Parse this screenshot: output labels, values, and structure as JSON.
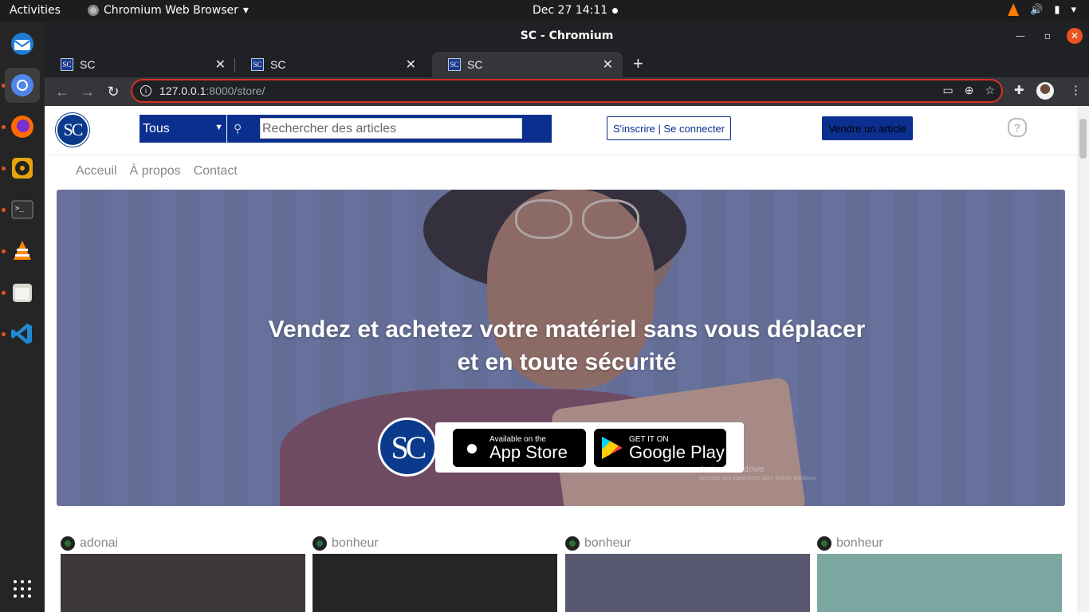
{
  "topbar": {
    "activities": "Activities",
    "app_name": "Chromium Web Browser",
    "clock": "Dec 27  14:11"
  },
  "dock": {
    "items": [
      "thunderbird-icon",
      "chromium-icon",
      "firefox-icon",
      "rhythmbox-icon",
      "terminal-icon",
      "vlc-icon",
      "files-icon",
      "vscode-icon"
    ]
  },
  "window": {
    "title": "SC - Chromium",
    "tabs": [
      {
        "label": "SC",
        "favicon": "SC"
      },
      {
        "label": "SC",
        "favicon": "SC"
      },
      {
        "label": "SC",
        "favicon": "SC"
      }
    ],
    "url_host": "127.0.0.1",
    "url_path": ":8000/store/"
  },
  "site": {
    "logo": "SC",
    "category": "Tous",
    "search_placeholder": "Rechercher des articles",
    "auth_label": "S'inscrire | Se connecter",
    "sell_label": "Vendre un article",
    "help": "?",
    "nav": [
      "Acceuil",
      "À propos",
      "Contact"
    ],
    "hero_title": "Vendez et achetez votre matériel sans vous déplacer et en toute sécurité",
    "hero_logo": "SC",
    "appstore_small": "Available on the",
    "appstore_big": "App Store",
    "play_small": "GET IT ON",
    "play_big": "Google Play",
    "watermark_line1": "Activer Windows",
    "watermark_line2": "Accédez aux paramètres pour activer Windows.",
    "cards": [
      {
        "seller": "adonai",
        "color": "#3d3939"
      },
      {
        "seller": "bonheur",
        "color": "#252527"
      },
      {
        "seller": "bonheur",
        "color": "#585870"
      },
      {
        "seller": "bonheur",
        "color": "#7aa8a0"
      }
    ]
  },
  "colors": {
    "brand": "#0b2f8f",
    "omnibox_border": "#d93025",
    "ubuntu_accent": "#e95420"
  }
}
